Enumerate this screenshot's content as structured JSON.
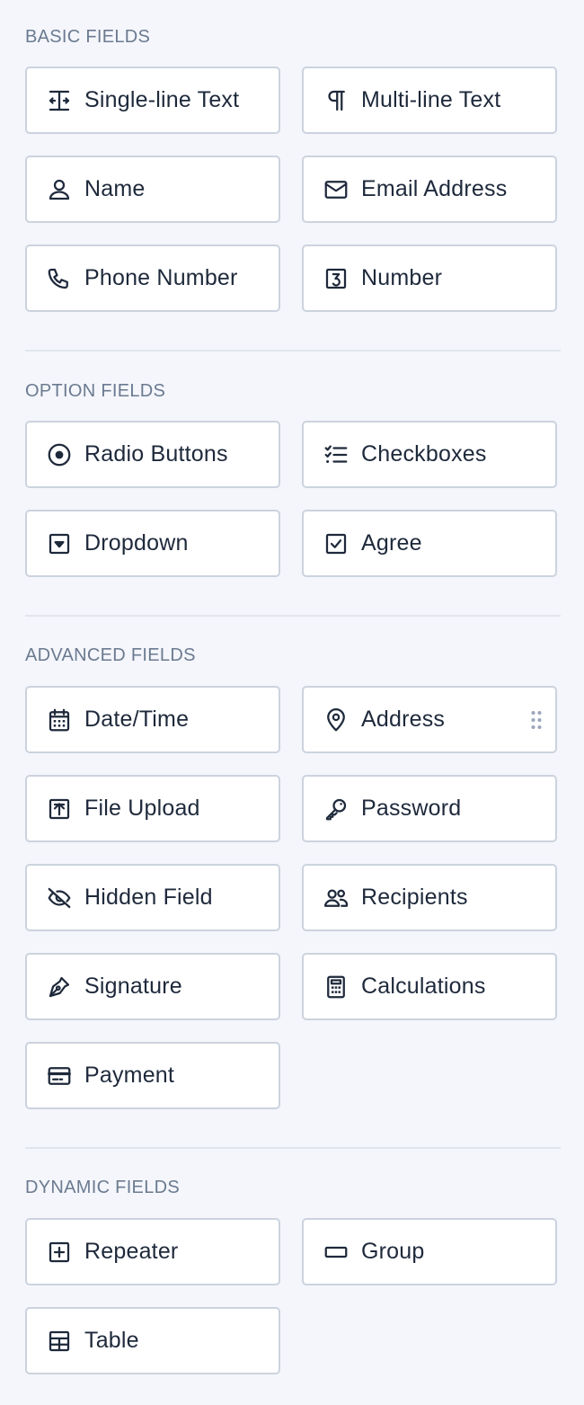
{
  "sections": {
    "basic": {
      "title": "BASIC FIELDS",
      "fields": [
        {
          "label": "Single-line Text",
          "icon": "text-cursor-icon"
        },
        {
          "label": "Multi-line Text",
          "icon": "paragraph-icon"
        },
        {
          "label": "Name",
          "icon": "user-icon"
        },
        {
          "label": "Email Address",
          "icon": "envelope-icon"
        },
        {
          "label": "Phone Number",
          "icon": "phone-icon"
        },
        {
          "label": "Number",
          "icon": "number-three-icon"
        }
      ]
    },
    "option": {
      "title": "OPTION FIELDS",
      "fields": [
        {
          "label": "Radio Buttons",
          "icon": "radio-icon"
        },
        {
          "label": "Checkboxes",
          "icon": "checklist-icon"
        },
        {
          "label": "Dropdown",
          "icon": "dropdown-icon"
        },
        {
          "label": "Agree",
          "icon": "checkbox-checked-icon"
        }
      ]
    },
    "advanced": {
      "title": "ADVANCED FIELDS",
      "fields": [
        {
          "label": "Date/Time",
          "icon": "calendar-icon"
        },
        {
          "label": "Address",
          "icon": "map-pin-icon"
        },
        {
          "label": "File Upload",
          "icon": "upload-icon"
        },
        {
          "label": "Password",
          "icon": "key-icon"
        },
        {
          "label": "Hidden Field",
          "icon": "eye-slash-icon"
        },
        {
          "label": "Recipients",
          "icon": "users-icon"
        },
        {
          "label": "Signature",
          "icon": "pen-nib-icon"
        },
        {
          "label": "Calculations",
          "icon": "calculator-icon"
        },
        {
          "label": "Payment",
          "icon": "credit-card-icon"
        }
      ]
    },
    "dynamic": {
      "title": "DYNAMIC FIELDS",
      "fields": [
        {
          "label": "Repeater",
          "icon": "plus-square-icon"
        },
        {
          "label": "Group",
          "icon": "rectangle-icon"
        },
        {
          "label": "Table",
          "icon": "table-icon"
        }
      ]
    }
  },
  "colors": {
    "background": "#f4f6fb",
    "button_border": "#ccd3de",
    "section_title": "#6b7a90",
    "text": "#1e293b"
  }
}
